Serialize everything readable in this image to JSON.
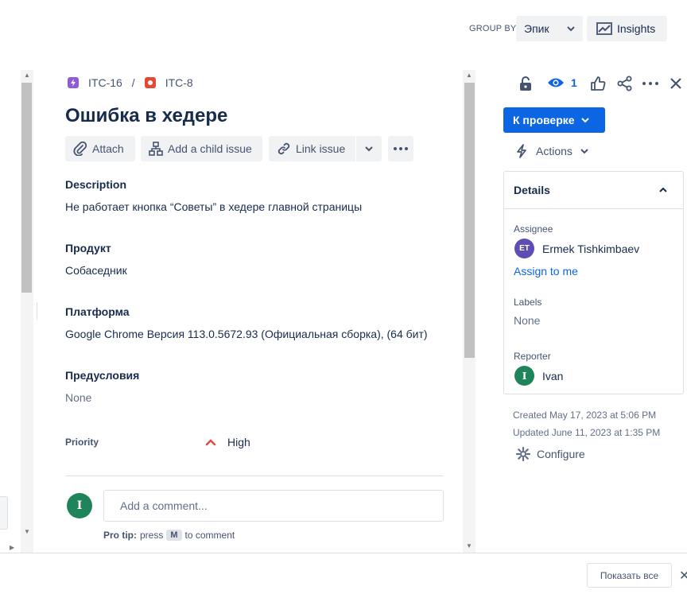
{
  "topbar": {
    "group_by_label": "GROUP BY",
    "group_by_value": "Эпик",
    "insights_label": "Insights"
  },
  "breadcrumb": {
    "parent_key": "ITC-16",
    "separator": "/",
    "issue_key": "ITC-8",
    "parent_icon_color": "#8f5bd6",
    "issue_icon_color": "#e34935"
  },
  "issue": {
    "title": "Ошибка в хедере",
    "toolbar": {
      "attach": "Attach",
      "add_child": "Add a child issue",
      "link_issue": "Link issue"
    },
    "fields": {
      "description_label": "Description",
      "description_value": "Не работает кнопка “Советы” в хедере главной страницы",
      "product_label": "Продукт",
      "product_value": "Собаседник",
      "platform_label": "Платформа",
      "platform_value": "Google Chrome Версия 113.0.5672.93 (Официальная сборка), (64 бит)",
      "preconditions_label": "Предусловия",
      "preconditions_value": "None",
      "priority_label": "Priority",
      "priority_value": "High"
    },
    "comment": {
      "avatar_initial": "I",
      "placeholder": "Add a comment...",
      "protip_bold": "Pro tip:",
      "protip_press": "press",
      "protip_key": "M",
      "protip_rest": "to comment"
    }
  },
  "sidebar": {
    "watch_count": "1",
    "status_label": "К проверке",
    "actions_label": "Actions",
    "details_title": "Details",
    "assignee_label": "Assignee",
    "assignee_initials": "ET",
    "assignee_name": "Ermek Tishkimbaev",
    "assign_to_me": "Assign to me",
    "labels_label": "Labels",
    "labels_value": "None",
    "reporter_label": "Reporter",
    "reporter_initial": "I",
    "reporter_name": "Ivan",
    "created": "Created May 17, 2023 at 5:06 PM",
    "updated": "Updated June 11, 2023 at 1:35 PM",
    "configure": "Configure"
  },
  "footer": {
    "show_all": "Показать все",
    "close_symbol": "✕"
  },
  "colors": {
    "primary": "#0c66e4",
    "avatar_et": "#5e4db2",
    "avatar_i": "#1f845a",
    "priority_high": "#e2483d"
  }
}
